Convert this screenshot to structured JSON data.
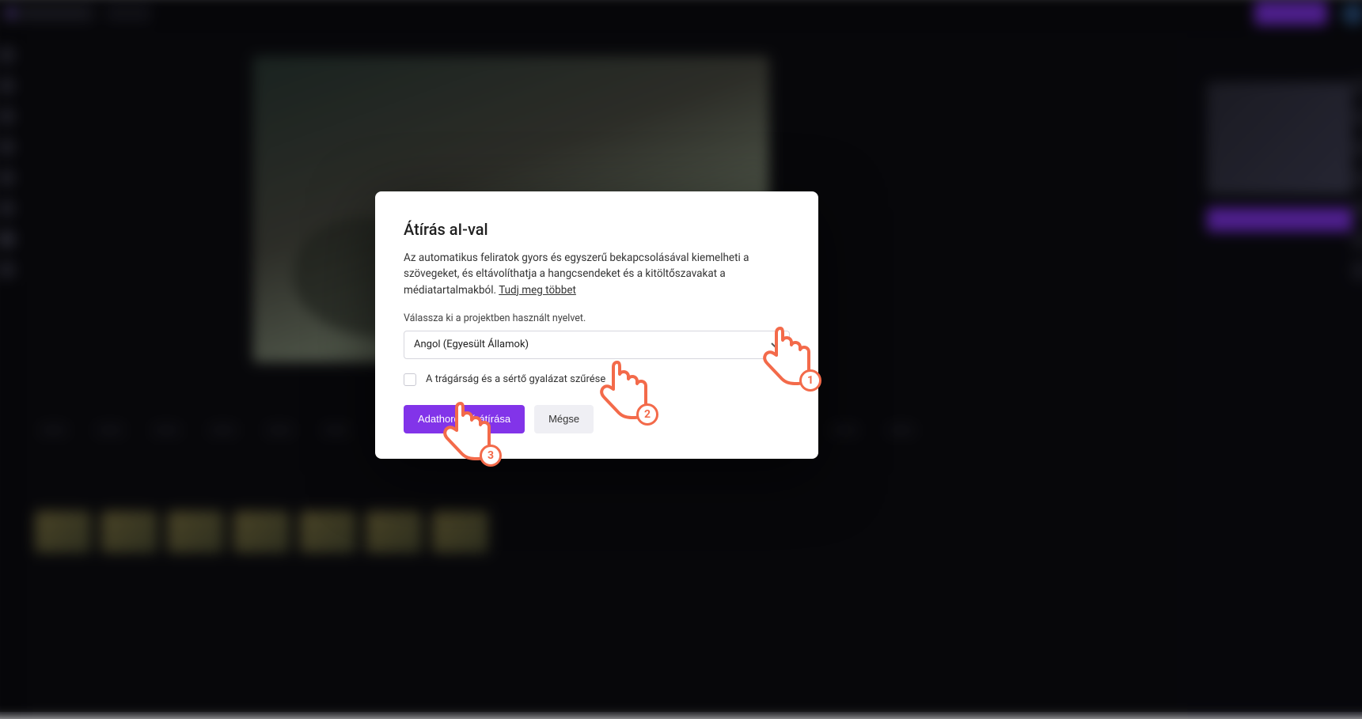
{
  "modal": {
    "title": "Átírás aI-val",
    "description_main": "Az automatikus feliratok gyors és egyszerű bekapcsolásával kiemelheti a szövegeket, és eltávolíthatja a hangcsendeket és a kitöltőszavakat a médiatartalmakból. ",
    "description_link": "Tudj meg többet",
    "language_label": "Válassza ki a projektben használt nyelvet.",
    "language_value": "Angol (Egyesült Államok)",
    "filter_label": "A trágárság és a sértő gyalázat szűrése",
    "primary_button": "Adathordozó átírása",
    "secondary_button": "Mégse"
  },
  "callouts": {
    "c1": "1",
    "c2": "2",
    "c3": "3"
  }
}
